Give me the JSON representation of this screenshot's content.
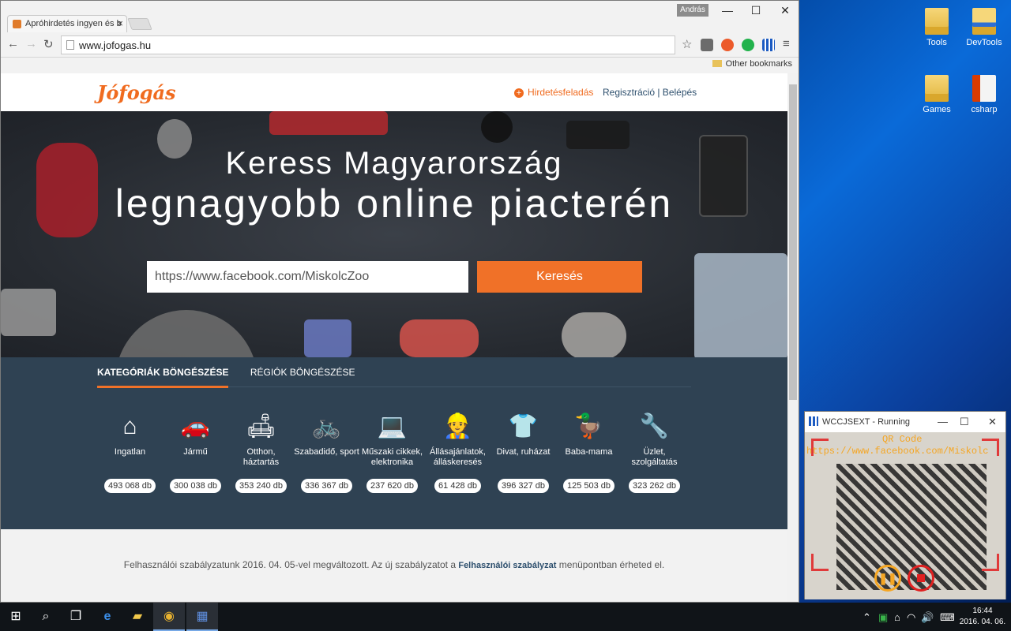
{
  "desktop": {
    "icons": [
      {
        "label": "Tools"
      },
      {
        "label": "DevTools"
      },
      {
        "label": "Games"
      },
      {
        "label": "csharp"
      }
    ]
  },
  "browser": {
    "tab_title": "Apróhirdetés ingyen és b",
    "user_name": "András",
    "url": "www.jofogas.hu",
    "bookmark_other": "Other bookmarks"
  },
  "site": {
    "logo": "Jófogás",
    "post_ad": "Hirdetésfeladás",
    "auth": "Regisztráció | Belépés",
    "hero_line1": "Keress Magyarország",
    "hero_line2": "legnagyobb online piacterén",
    "search_value": "https://www.facebook.com/MiskolcZoo",
    "search_button": "Keresés",
    "tabs": [
      "KATEGÓRIÁK BÖNGÉSZÉSE",
      "RÉGIÓK BÖNGÉSZÉSE"
    ],
    "categories": [
      {
        "icon": "house-icon",
        "name": "Ingatlan",
        "count": "493 068 db"
      },
      {
        "icon": "car-icon",
        "name": "Jármű",
        "count": "300 038 db"
      },
      {
        "icon": "sofa-icon",
        "name": "Otthon, háztartás",
        "count": "353 240 db"
      },
      {
        "icon": "bicycle-icon",
        "name": "Szabadidő, sport",
        "count": "336 367 db"
      },
      {
        "icon": "laptop-icon",
        "name": "Műszaki cikkek, elektronika",
        "count": "237 620 db"
      },
      {
        "icon": "worker-icon",
        "name": "Állásajánlatok, álláskeresés",
        "count": "61 428 db"
      },
      {
        "icon": "tshirt-icon",
        "name": "Divat, ruházat",
        "count": "396 327 db"
      },
      {
        "icon": "duck-icon",
        "name": "Baba-mama",
        "count": "125 503 db"
      },
      {
        "icon": "tool-icon",
        "name": "Üzlet, szolgáltatás",
        "count": "323 262 db"
      }
    ],
    "footer_before": "Felhasználói szabályzatunk 2016. 04. 05-vel megváltozott. Az új szabályzatot a ",
    "footer_link": "Felhasználói szabályzat",
    "footer_after": " menüpontban érheted el."
  },
  "qr_window": {
    "title": "WCCJSEXT - Running",
    "overlay_line1": "QR Code",
    "overlay_line2": "https://www.facebook.com/Miskolc"
  },
  "taskbar": {
    "time": "16:44",
    "date": "2016. 04. 06."
  },
  "colors": {
    "brand_orange": "#f07128",
    "category_bg": "#2f4253"
  }
}
